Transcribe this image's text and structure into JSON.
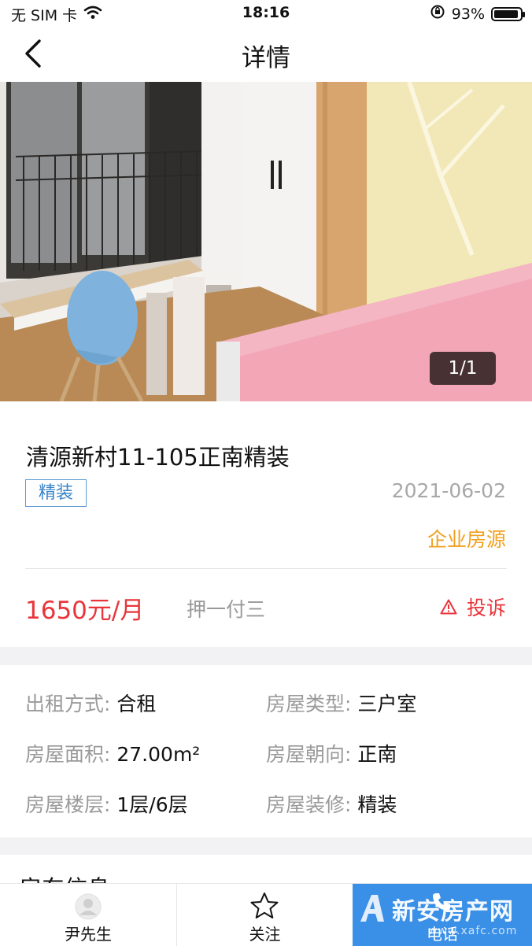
{
  "status": {
    "carrier": "无 SIM 卡",
    "time": "18:16",
    "battery": "93%",
    "battery_level": 0.93
  },
  "nav": {
    "title": "详情"
  },
  "gallery": {
    "counter": "1/1"
  },
  "listing": {
    "name": "清源新村11-105正南精装",
    "tag": "精装",
    "date": "2021-06-02",
    "source": "企业房源",
    "price": "1650元/月",
    "payment": "押一付三",
    "complain": "投诉"
  },
  "attributes": [
    {
      "key": "出租方式: ",
      "value": "合租"
    },
    {
      "key": "房屋类型: ",
      "value": "三户室"
    },
    {
      "key": "房屋面积: ",
      "value": "27.00m²"
    },
    {
      "key": "房屋朝向: ",
      "value": "正南"
    },
    {
      "key": "房屋楼层: ",
      "value": "1层/6层"
    },
    {
      "key": "房屋装修: ",
      "value": "精装"
    }
  ],
  "landlord_section": {
    "title": "房东信息"
  },
  "tabbar": {
    "contact_name": "尹先生",
    "follow": "关注",
    "call": "电话"
  },
  "watermark": {
    "text": "新安房产网",
    "sub": "www.xafc.com"
  },
  "colors": {
    "price_red": "#e8353b",
    "tag_blue": "#3a84c8",
    "source_orange": "#f0a020",
    "call_blue": "#3a8fe6"
  }
}
